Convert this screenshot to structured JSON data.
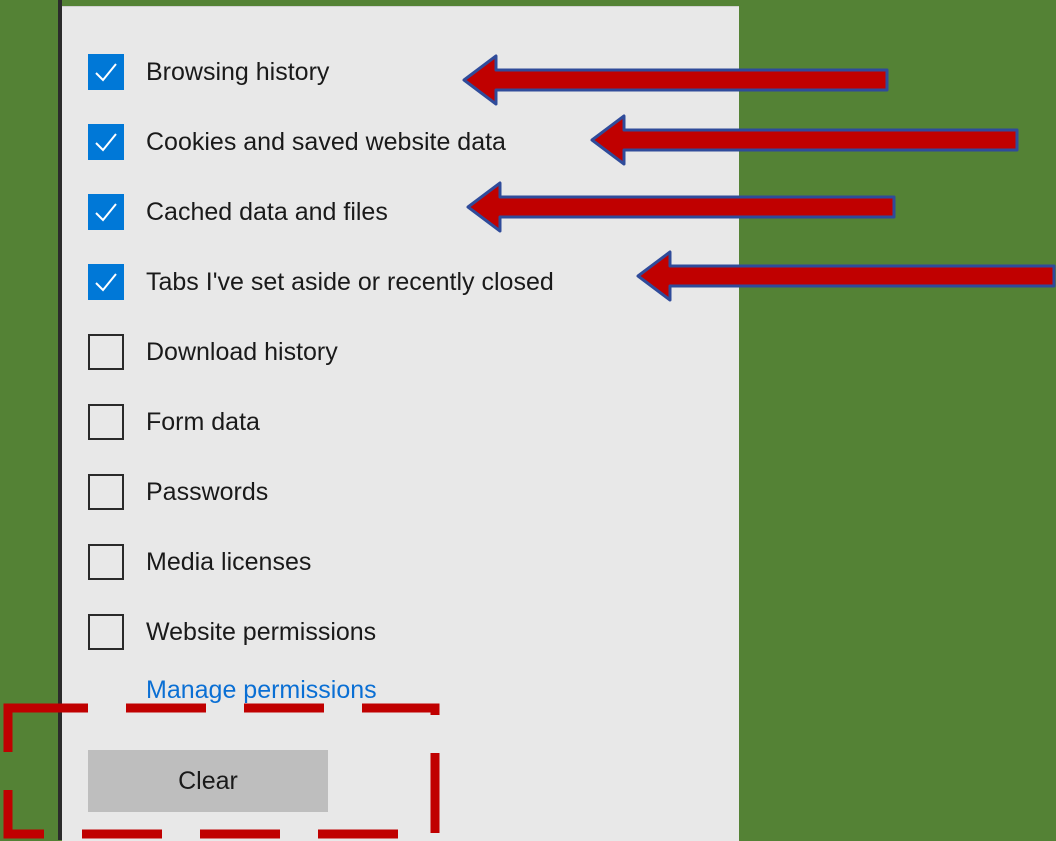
{
  "options": [
    {
      "label": "Browsing history",
      "checked": true
    },
    {
      "label": "Cookies and saved website data",
      "checked": true
    },
    {
      "label": "Cached data and files",
      "checked": true
    },
    {
      "label": "Tabs I've set aside or recently closed",
      "checked": true
    },
    {
      "label": "Download history",
      "checked": false
    },
    {
      "label": "Form data",
      "checked": false
    },
    {
      "label": "Passwords",
      "checked": false
    },
    {
      "label": "Media licenses",
      "checked": false
    },
    {
      "label": "Website permissions",
      "checked": false
    }
  ],
  "manage_link": "Manage permissions",
  "clear_button": "Clear",
  "colors": {
    "background": "#548235",
    "panel": "#e8e8e8",
    "checkbox_checked": "#0078d7",
    "link": "#0a6fd4",
    "button": "#bebebe",
    "annotation_arrow": "#c00000",
    "annotation_arrow_outline": "#2f4b9a"
  }
}
